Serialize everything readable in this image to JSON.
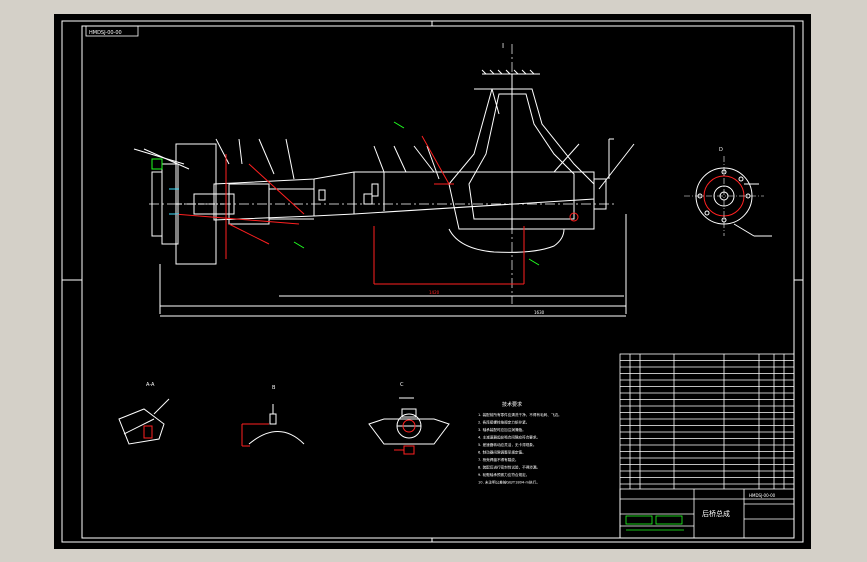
{
  "drawing": {
    "drawing_number": "HMDSJ-00-00",
    "title_block_number": "HMDSJ-00-00",
    "title_block_name": "后桥总成",
    "tech_req_title": "技术要求",
    "tech_req_lines": [
      "1. 装配前所有零件应清洗干净，不得有毛刺、飞边。",
      "2. 各连接螺栓按规定力矩拧紧。",
      "3. 轴承装配时应加注润滑脂。",
      "4. 主减速器齿轮啮合间隙应符合要求。",
      "5. 差速器转动应灵活，无卡滞现象。",
      "6. 制动器间隙调整至规定值。",
      "7. 桥壳焊缝不得有裂纹。",
      "8. 装配后进行密封性试验，不得渗漏。",
      "9. 轮毂轴承预紧力应符合规定。",
      "10. 未注明公差按GB/T1804-m执行。"
    ],
    "view_labels": {
      "main": "I",
      "section_a": "A-A",
      "section_b": "B",
      "section_c": "C",
      "view_d": "D"
    },
    "dimensions": {
      "overall_width": "1630",
      "track": "1420"
    }
  },
  "colors": {
    "canvas": "#000000",
    "frame": "#d4d0c8",
    "white": "#ffffff",
    "red": "#ff2020",
    "green": "#20ff20",
    "cyan": "#40e0ff",
    "yellow": "#ffff40"
  }
}
